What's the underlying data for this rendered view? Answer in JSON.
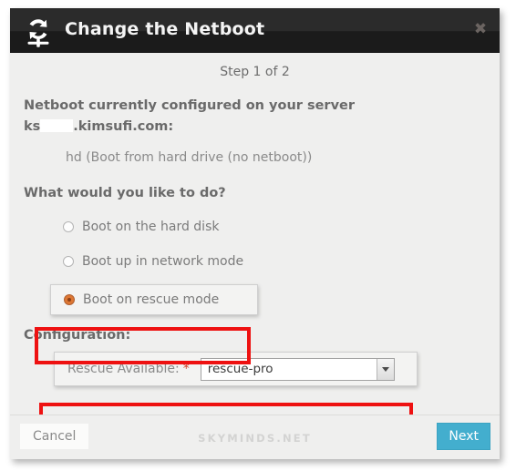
{
  "window": {
    "title": "Change the Netboot",
    "icon": "netboot-refresh-icon",
    "close_label": "✖"
  },
  "body": {
    "step_label": "Step 1 of 2",
    "intro_line1": "Netboot currently configured on your server",
    "intro_prefix": "ks",
    "intro_suffix": ".kimsufi.com:",
    "current_value": "hd (Boot from hard drive (no netboot))",
    "question": "What would you like to do?",
    "options": [
      {
        "label": "Boot on the hard disk",
        "checked": false,
        "highlighted": false
      },
      {
        "label": "Boot up in network mode",
        "checked": false,
        "highlighted": false
      },
      {
        "label": "Boot on rescue mode",
        "checked": true,
        "highlighted": true
      }
    ],
    "config_title": "Configuration:",
    "config_field_label": "Rescue Available:",
    "config_required_mark": "*",
    "config_select_value": "rescue-pro",
    "config_select_options": [
      "rescue-pro"
    ]
  },
  "footer": {
    "cancel_label": "Cancel",
    "next_label": "Next",
    "watermark": "SKYMINDS.NET"
  },
  "colors": {
    "titlebar": "#2b2b2b",
    "dialog_bg": "#efefee",
    "next_button": "#43aece",
    "required_asterisk": "#d0402a",
    "radio_checked": "#dd7733",
    "annotation_red": "#ee1111",
    "text_muted": "#8a8a8a",
    "text_heading": "#6a6a6a"
  }
}
